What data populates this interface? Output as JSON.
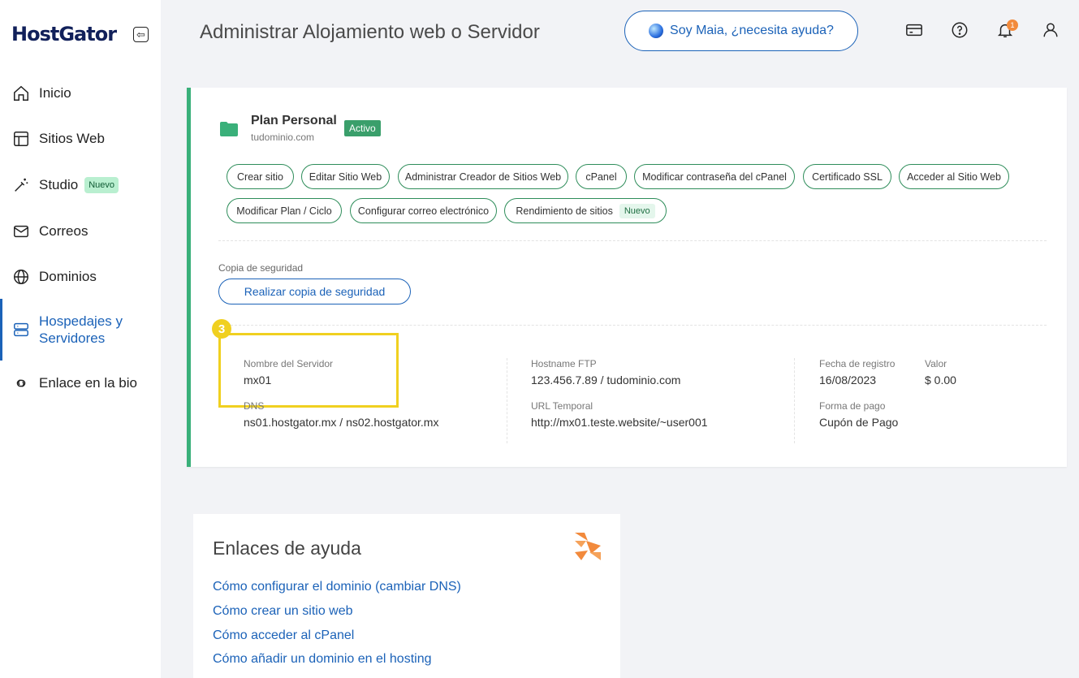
{
  "sidebar": {
    "logo": "HostGator",
    "items": [
      {
        "label": "Inicio",
        "icon": "home-icon"
      },
      {
        "label": "Sitios Web",
        "icon": "layout-icon"
      },
      {
        "label": "Studio",
        "icon": "magic-wand-icon",
        "badge": "Nuevo"
      },
      {
        "label": "Correos",
        "icon": "mail-icon"
      },
      {
        "label": "Dominios",
        "icon": "globe-icon"
      },
      {
        "label": "Hospedajes y Servidores",
        "label_line1": "Hospedajes y",
        "label_line2": "Servidores",
        "icon": "server-icon",
        "active": true
      },
      {
        "label": "Enlace en la bio",
        "icon": "link-icon"
      }
    ]
  },
  "header": {
    "title": "Administrar Alojamiento web o Servidor",
    "maia_button": "Soy Maia, ¿necesita ayuda?",
    "notification_count": "1",
    "icons": [
      "billing-card-icon",
      "help-icon",
      "bell-icon",
      "user-icon"
    ]
  },
  "plan": {
    "name": "Plan Personal",
    "domain": "tudominio.com",
    "status": "Activo",
    "actions_row1": [
      "Crear sitio",
      "Editar Sitio Web",
      "Administrar Creador de Sitios Web",
      "cPanel",
      "Modificar contraseña del cPanel",
      "Certificado SSL",
      "Acceder al Sitio Web"
    ],
    "actions_row2": [
      "Modificar Plan / Ciclo",
      "Configurar correo electrónico",
      "Rendimiento de sitios"
    ],
    "new_badge": "Nuevo",
    "backup_label": "Copia de seguridad",
    "backup_button": "Realizar copia de seguridad",
    "step_number": "3",
    "details": {
      "server_name_label": "Nombre del Servidor",
      "server_name": "mx01",
      "dns_label": "DNS",
      "dns": "ns01.hostgator.mx / ns02.hostgator.mx",
      "ftp_label": "Hostname FTP",
      "ftp": "123.456.7.89 / tudominio.com",
      "temp_url_label": "URL Temporal",
      "temp_url": "http://mx01.teste.website/~user001",
      "reg_date_label": "Fecha de registro",
      "reg_date": "16/08/2023",
      "value_label": "Valor",
      "value": "$ 0.00",
      "payment_label": "Forma de pago",
      "payment": "Cupón de Pago"
    }
  },
  "help": {
    "title": "Enlaces de ayuda",
    "links": [
      "Cómo configurar el dominio (cambiar DNS)",
      "Cómo crear un sitio web",
      "Cómo acceder al cPanel",
      "Cómo añadir un dominio en el hosting"
    ]
  },
  "colors": {
    "accent": "#1b62b8",
    "success": "#3ab07a",
    "highlight": "#f0d020",
    "brand_orange": "#f28a3c"
  }
}
